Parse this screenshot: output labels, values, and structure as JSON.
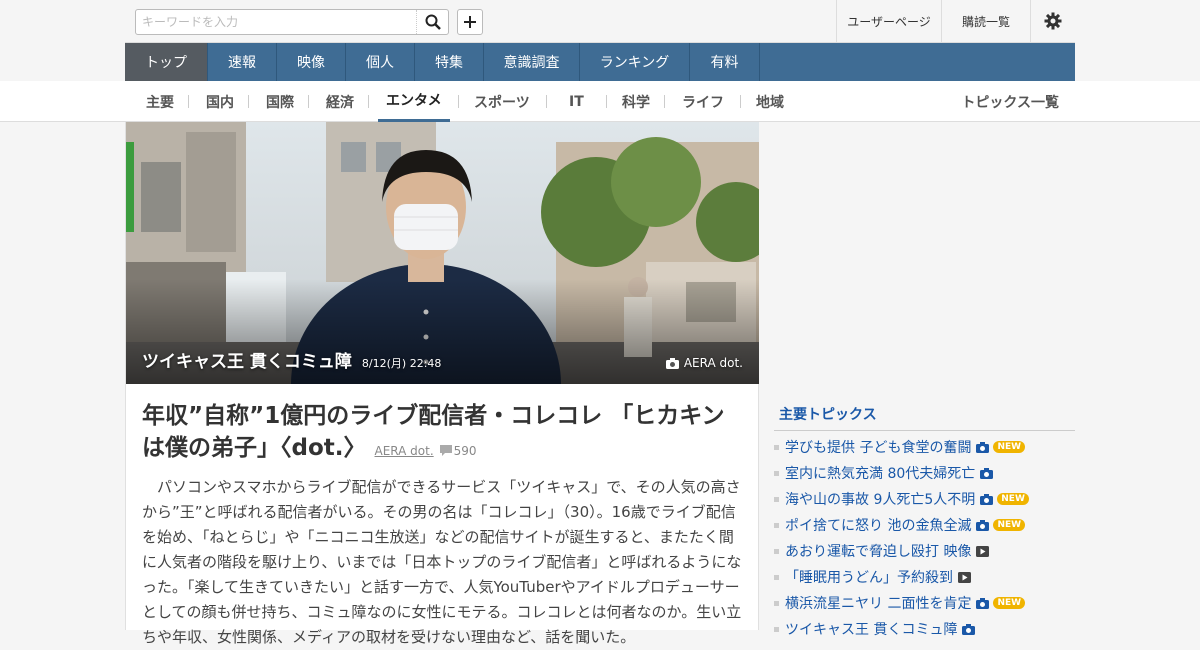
{
  "header": {
    "search_placeholder": "キーワードを入力",
    "user_page": "ユーザーページ",
    "subscriptions": "購読一覧"
  },
  "main_nav": [
    "トップ",
    "速報",
    "映像",
    "個人",
    "特集",
    "意識調査",
    "ランキング",
    "有料"
  ],
  "sub_nav": [
    "主要",
    "国内",
    "国際",
    "経済",
    "エンタメ",
    "スポーツ",
    "IT",
    "科学",
    "ライフ",
    "地域"
  ],
  "sub_nav_active": "エンタメ",
  "topics_all": "トピックス一覧",
  "hero": {
    "caption": "ツイキャス王 貫くコミュ障",
    "timestamp": "8/12(月) 22:48",
    "source": "AERA dot."
  },
  "article": {
    "title": "年収”自称”1億円のライブ配信者・コレコレ 「ヒカキンは僕の弟子」〈dot.〉",
    "source": "AERA dot.",
    "comments": "590",
    "body": "パソコンやスマホからライブ配信ができるサービス「ツイキャス」で、その人気の高さから”王”と呼ばれる配信者がいる。その男の名は「コレコレ」（30）。16歳でライブ配信を始め、「ねとらじ」や「ニコニコ生放送」などの配信サイトが誕生すると、またたく間に人気者の階段を駆け上り、いまでは「日本トップのライブ配信者」と呼ばれるようになった。「楽して生きていきたい」と話す一方で、人気YouTuberやアイドルプロデューサーとしての顔も併せ持ち、コミュ障なのに女性にモテる。コレコレとは何者なのか。生い立ちや年収、女性関係、メディアの取材を受けない理由など、話を聞いた。"
  },
  "topics": {
    "heading": "主要トピックス",
    "items": [
      {
        "label": "学びも提供 子ども食堂の奮闘",
        "icon": "camera-icon",
        "new": true
      },
      {
        "label": "室内に熱気充満 80代夫婦死亡",
        "icon": "camera-icon",
        "new": false
      },
      {
        "label": "海や山の事故 9人死亡5人不明",
        "icon": "camera-icon",
        "new": true
      },
      {
        "label": "ポイ捨てに怒り 池の金魚全滅",
        "icon": "camera-icon",
        "new": true
      },
      {
        "label": "あおり運転で脅迫し殴打 映像",
        "icon": "video-icon",
        "new": false
      },
      {
        "label": "「睡眠用うどん」予約殺到",
        "icon": "video-icon",
        "new": false
      },
      {
        "label": "横浜流星ニヤリ 二面性を肯定",
        "icon": "camera-icon",
        "new": true
      },
      {
        "label": "ツイキャス王 貫くコミュ障",
        "icon": "camera-icon",
        "new": false
      }
    ],
    "new_label": "NEW"
  }
}
